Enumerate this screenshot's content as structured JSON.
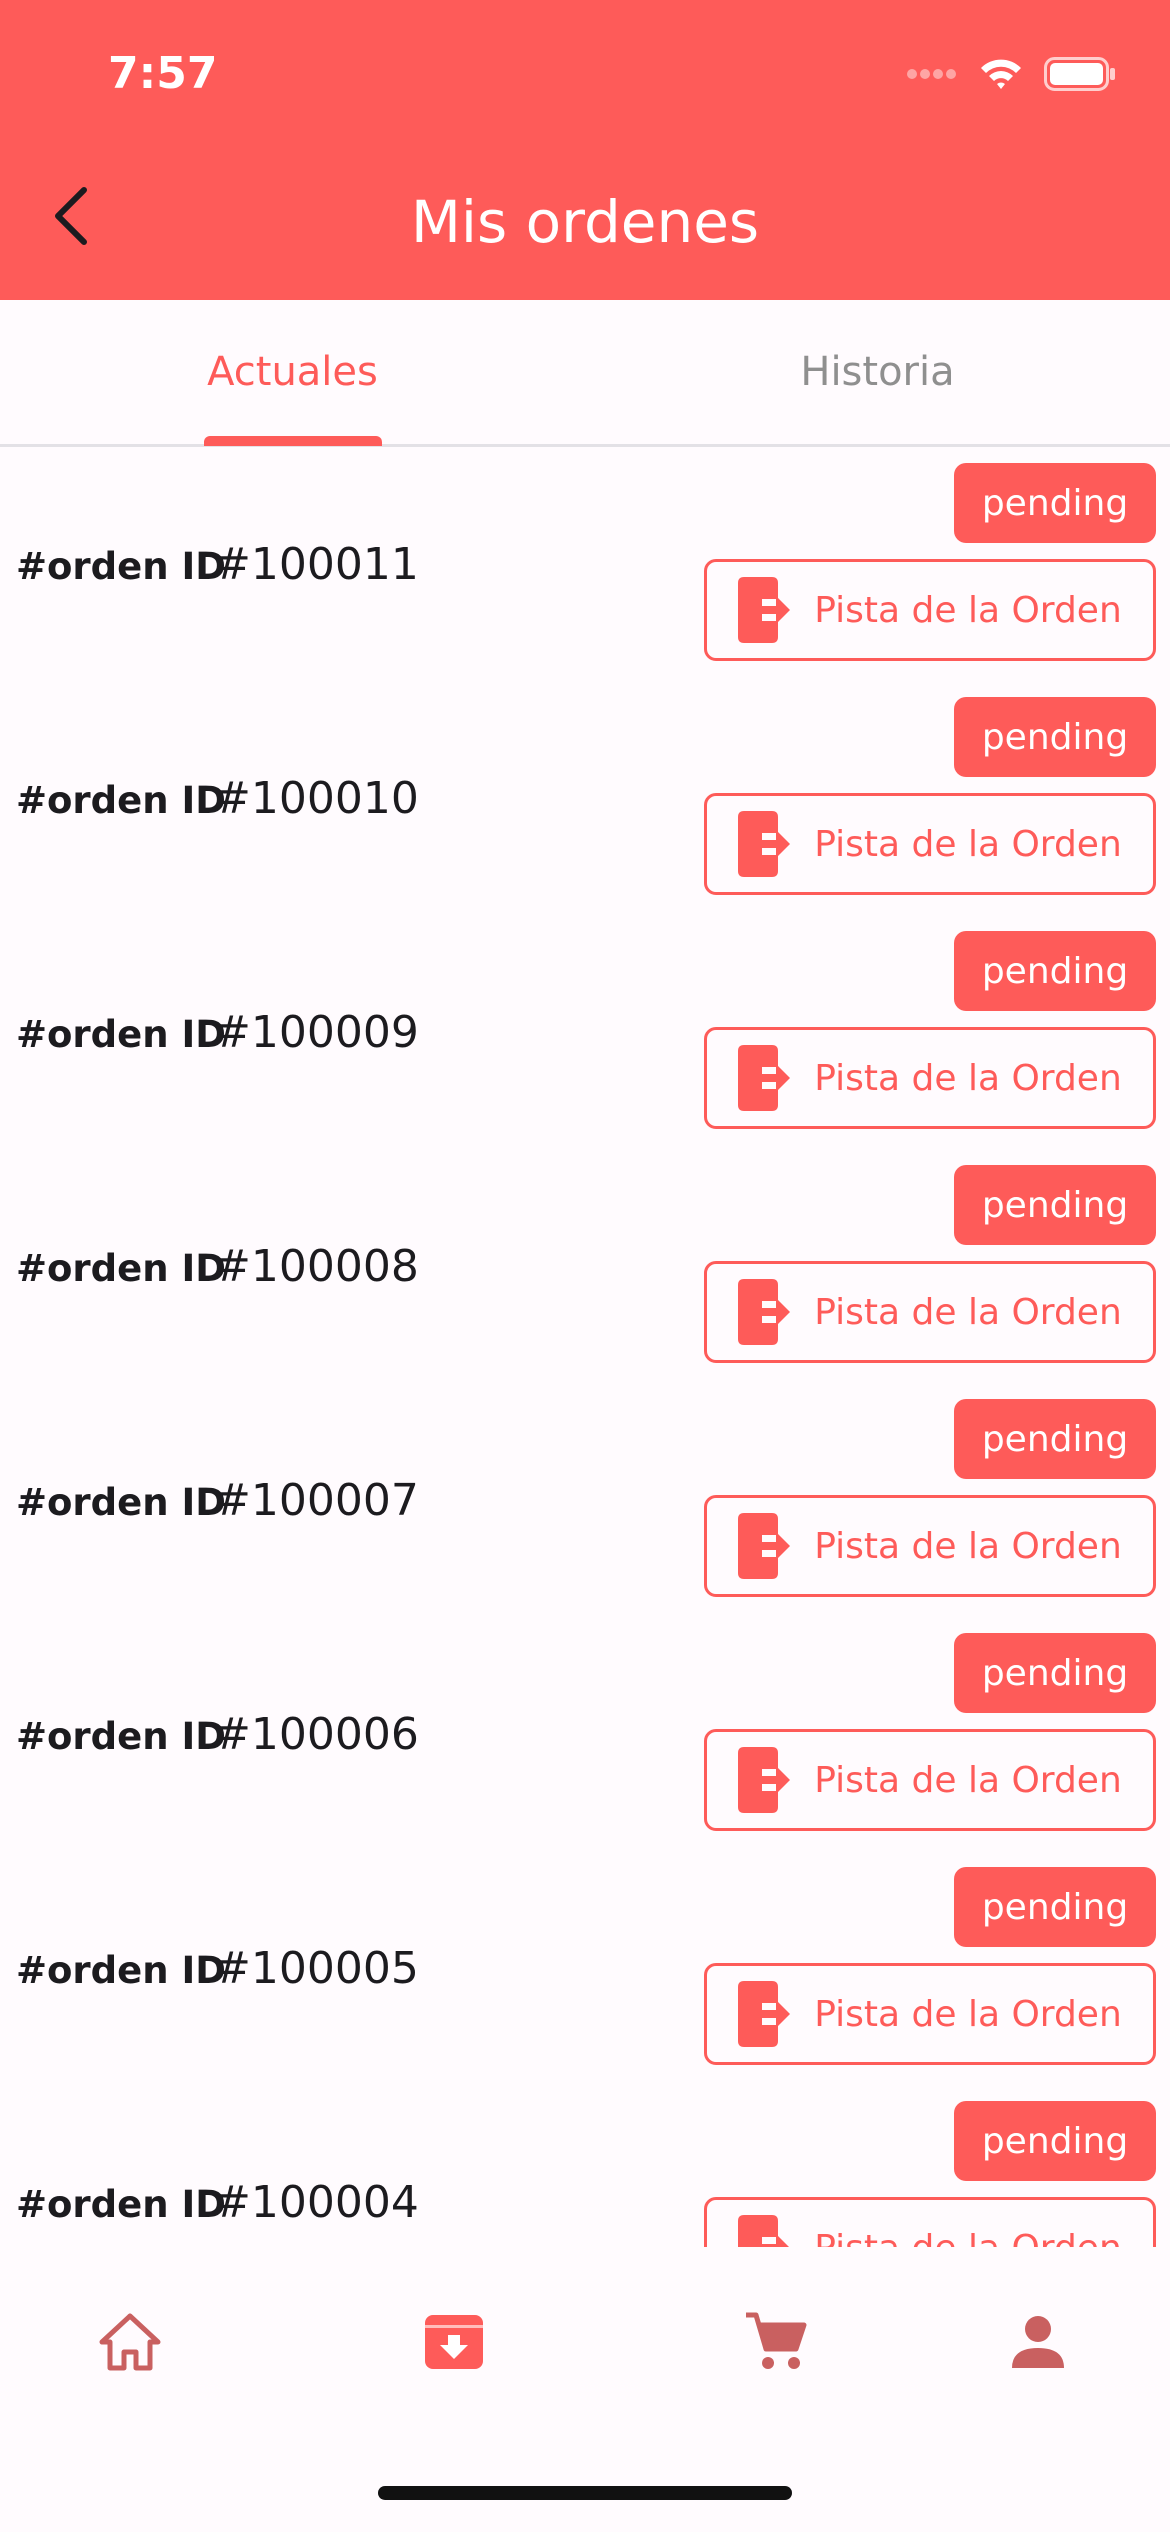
{
  "status": {
    "time": "7:57"
  },
  "header": {
    "title": "Mis ordenes"
  },
  "tabs": [
    {
      "label": "Actuales"
    },
    {
      "label": "Historia"
    }
  ],
  "orders": [
    {
      "label": "#orden ID",
      "id": "#100011",
      "status": "pending",
      "action": "Pista de la Orden"
    },
    {
      "label": "#orden ID",
      "id": "#100010",
      "status": "pending",
      "action": "Pista de la Orden"
    },
    {
      "label": "#orden ID",
      "id": "#100009",
      "status": "pending",
      "action": "Pista de la Orden"
    },
    {
      "label": "#orden ID",
      "id": "#100008",
      "status": "pending",
      "action": "Pista de la Orden"
    },
    {
      "label": "#orden ID",
      "id": "#100007",
      "status": "pending",
      "action": "Pista de la Orden"
    },
    {
      "label": "#orden ID",
      "id": "#100006",
      "status": "pending",
      "action": "Pista de la Orden"
    },
    {
      "label": "#orden ID",
      "id": "#100005",
      "status": "pending",
      "action": "Pista de la Orden"
    },
    {
      "label": "#orden ID",
      "id": "#100004",
      "status": "pending",
      "action": "Pista de la Orden"
    }
  ],
  "nav": {
    "items": [
      {
        "icon": "home-icon"
      },
      {
        "icon": "archive-download-icon"
      },
      {
        "icon": "cart-icon"
      },
      {
        "icon": "person-icon"
      }
    ]
  },
  "colors": {
    "accent": "#fe5b59",
    "nav_inactive": "#c96060",
    "background": "#fffbfe"
  }
}
